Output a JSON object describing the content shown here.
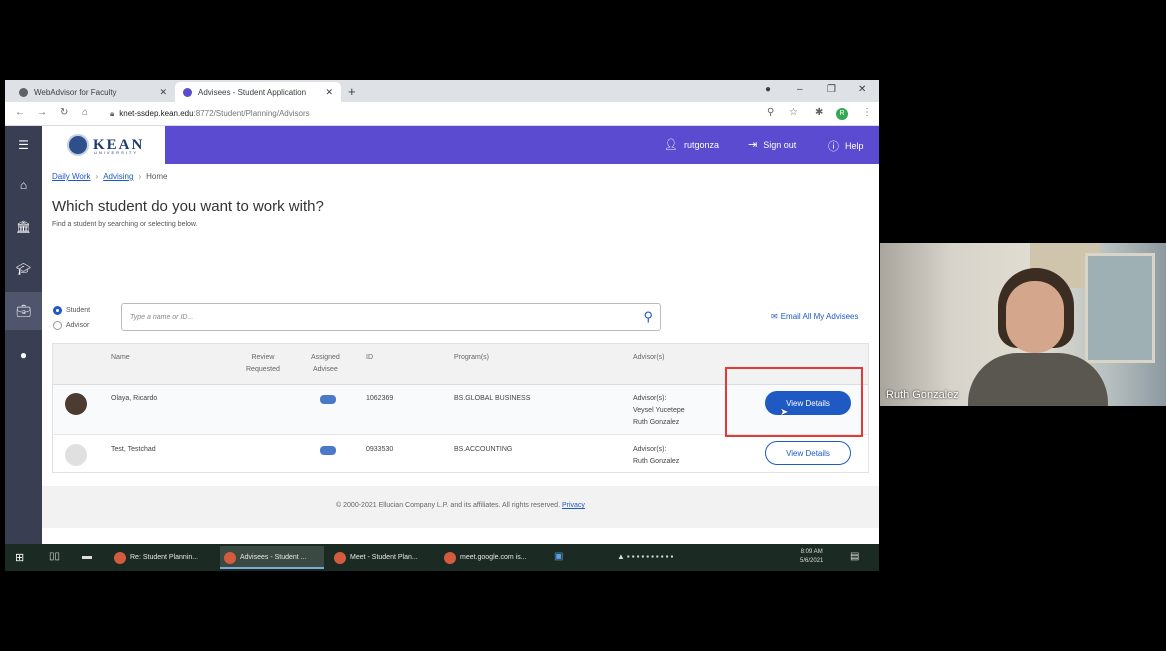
{
  "browser": {
    "tabs": [
      {
        "label": "WebAdvisor for Faculty"
      },
      {
        "label": "Advisees - Student Application"
      }
    ],
    "new_tab": "+",
    "controls": {
      "min": "–",
      "max": "❐",
      "close": "✕"
    },
    "url_host": "knet-ssdep.kean.edu",
    "url_path": ":8772/Student/Planning/Advisors"
  },
  "app": {
    "logo_text": "KEAN",
    "logo_sub": "UNIVERSITY",
    "user": "rutgonza",
    "sign_out": "Sign out",
    "help": "Help",
    "breadcrumbs": [
      "Daily Work",
      "Advising",
      "Home"
    ],
    "title": "Which student do you want to work with?",
    "subtitle": "Find a student by searching or selecting below.",
    "radio_student": "Student",
    "radio_advisor": "Advisor",
    "search_placeholder": "Type a name or ID...",
    "email_all": "Email All My Advisees",
    "columns": {
      "name": "Name",
      "review_1": "Review",
      "review_2": "Requested",
      "assigned_1": "Assigned",
      "assigned_2": "Advisee",
      "id": "ID",
      "programs": "Program(s)",
      "advisors": "Advisor(s)"
    },
    "rows": [
      {
        "name": "Olaya, Ricardo",
        "id": "1062369",
        "program": "BS.GLOBAL BUSINESS",
        "advisors_label": "Advisor(s):",
        "advisor_1": "Veysel Yucetepe",
        "advisor_2": "Ruth Gonzalez",
        "button": "View Details"
      },
      {
        "name": "Test, Testchad",
        "id": "0933530",
        "program": "BS.ACCOUNTING",
        "advisors_label": "Advisor(s):",
        "advisor_1": "Ruth Gonzalez",
        "button": "View Details"
      }
    ],
    "footer_text": "© 2000-2021 Ellucian Company L.P. and its affiliates. All rights reserved.",
    "footer_link": "Privacy"
  },
  "taskbar": {
    "apps": [
      {
        "label": "Re: Student Plannin..."
      },
      {
        "label": "Advisees - Student ..."
      },
      {
        "label": "Meet - Student Plan..."
      },
      {
        "label": "meet.google.com is..."
      }
    ],
    "time": "8:09 AM",
    "date": "5/6/2021"
  },
  "video": {
    "participant": "Ruth Gonzalez"
  },
  "colors": {
    "topbar": "#5b4bd1",
    "primary": "#1f59c4",
    "leftnav": "#3a3e52",
    "highlight": "#e53935"
  }
}
